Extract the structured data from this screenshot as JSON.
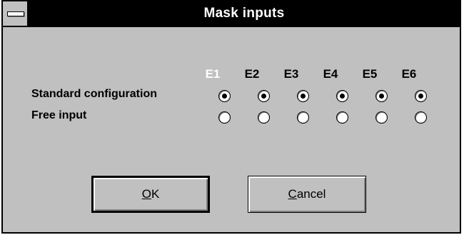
{
  "window": {
    "title": "Mask inputs",
    "system_menu_icon": "system-menu-dash-icon"
  },
  "columns": [
    "E1",
    "E2",
    "E3",
    "E4",
    "E5",
    "E6"
  ],
  "rows": [
    {
      "label": "Standard configuration",
      "selected": [
        true,
        true,
        true,
        true,
        true,
        true
      ]
    },
    {
      "label": "Free input",
      "selected": [
        false,
        false,
        false,
        false,
        false,
        false
      ]
    }
  ],
  "buttons": {
    "ok": {
      "mnemonic": "O",
      "rest": "K"
    },
    "cancel": {
      "mnemonic": "C",
      "rest": "ancel"
    }
  },
  "colors": {
    "dialog_bg": "#c0c0c0",
    "title_bar": "#000000",
    "title_text": "#ffffff"
  }
}
